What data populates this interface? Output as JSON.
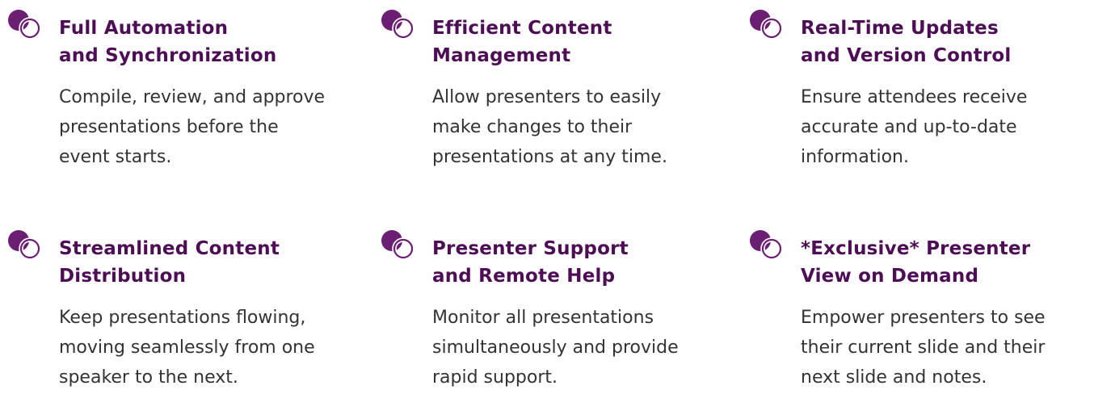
{
  "colors": {
    "accent": "#6b1f73",
    "title": "#4e0e55",
    "body_text": "#333333",
    "background": "#ffffff"
  },
  "features": [
    {
      "icon": "overlapping-circles-icon",
      "title_line1": "Full Automation",
      "title_line2": "and Synchronization",
      "desc_line1": "Compile, review, and approve",
      "desc_line2": "presentations before the",
      "desc_line3": "event starts."
    },
    {
      "icon": "overlapping-circles-icon",
      "title_line1": "Efficient Content",
      "title_line2": "Management",
      "desc_line1": "Allow presenters to easily",
      "desc_line2": "make changes to their",
      "desc_line3": "presentations at any time."
    },
    {
      "icon": "overlapping-circles-icon",
      "title_line1": "Real-Time Updates",
      "title_line2": "and Version Control",
      "desc_line1": "Ensure attendees receive",
      "desc_line2": "accurate and up-to-date",
      "desc_line3": "information."
    },
    {
      "icon": "overlapping-circles-icon",
      "title_line1": "Streamlined Content",
      "title_line2": "Distribution",
      "desc_line1": "Keep presentations flowing,",
      "desc_line2": "moving seamlessly from one",
      "desc_line3": "speaker to the next."
    },
    {
      "icon": "overlapping-circles-icon",
      "title_line1": "Presenter Support",
      "title_line2": "and Remote Help",
      "desc_line1": "Monitor all presentations",
      "desc_line2": "simultaneously and provide",
      "desc_line3": "rapid support."
    },
    {
      "icon": "overlapping-circles-icon",
      "title_line1": "*Exclusive* Presenter",
      "title_line2": "View on Demand",
      "desc_line1": "Empower presenters to see",
      "desc_line2": "their current slide and their",
      "desc_line3": "next slide and notes."
    }
  ]
}
